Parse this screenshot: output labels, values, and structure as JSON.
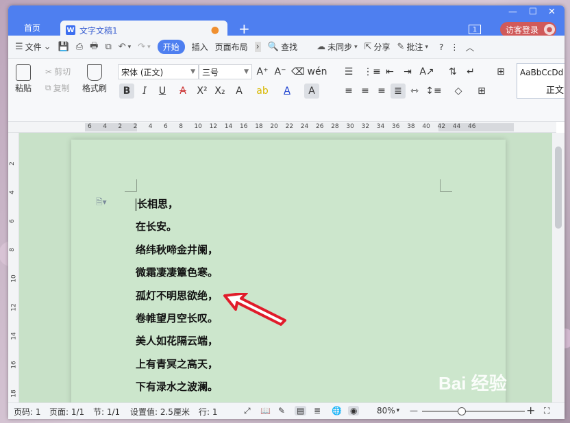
{
  "tabs": {
    "home": "首页",
    "doc": "文字文稿1",
    "add": "+"
  },
  "window": {
    "badge": "1",
    "visitor": "访客登录"
  },
  "menu": {
    "file": "文件",
    "items": [
      "开始",
      "插入",
      "页面布局"
    ],
    "search": "查找",
    "sync": "未同步",
    "share": "分享",
    "comment": "批注",
    "help": "?",
    "more": "⋮"
  },
  "ribbon": {
    "paste": "粘贴",
    "cut": "剪切",
    "copy": "复制",
    "format_painter": "格式刷",
    "font_name": "宋体 (正文)",
    "font_size": "三号",
    "style_sample": "AaBbCcDd",
    "style_name": "正文"
  },
  "ruler": {
    "numbers": [
      "6",
      "4",
      "2",
      "2",
      "4",
      "6",
      "8",
      "10",
      "12",
      "14",
      "16",
      "18",
      "20",
      "22",
      "24",
      "26",
      "28",
      "30",
      "32",
      "34",
      "36",
      "38",
      "40",
      "42",
      "44",
      "46"
    ],
    "vnumbers": [
      "2",
      "4",
      "6",
      "8",
      "10",
      "12",
      "14",
      "16",
      "18"
    ]
  },
  "document": {
    "lines": [
      "长相思，",
      "在长安。",
      "络纬秋啼金井阑，",
      "微霜凄凄簟色寒。",
      "孤灯不明思欲绝，",
      "卷帷望月空长叹。",
      "美人如花隔云端，",
      "上有青冥之高天，",
      "下有渌水之波澜。"
    ]
  },
  "status": {
    "page_num": "页码: 1",
    "pages": "页面: 1/1",
    "section": "节: 1/1",
    "setting": "设置值: 2.5厘米",
    "row": "行: 1",
    "zoom": "80%"
  },
  "watermark": "Bai 经验",
  "colors": {
    "accent": "#4e7ff0",
    "page_bg": "#cce6cc",
    "arrow": "#e01c2a"
  }
}
